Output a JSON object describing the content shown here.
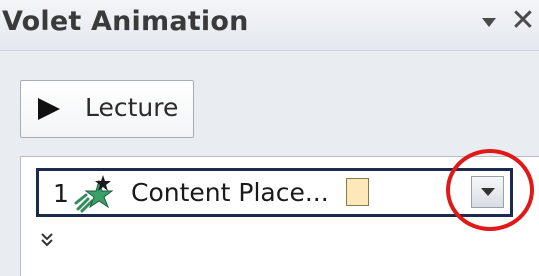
{
  "pane": {
    "title": "Volet Animation",
    "close_glyph": "✕",
    "menu_icon": "triangle-down-icon"
  },
  "play": {
    "label": "Lecture",
    "icon": "play-icon"
  },
  "animation_list": {
    "items": [
      {
        "number": "1",
        "label": "Content Place...",
        "effect_icon": "green-star-entrance-icon",
        "timing_color": "#fce8b8"
      }
    ],
    "expand_icon": "double-chevron-down-icon"
  },
  "annotation": {
    "highlight_color": "#e01818"
  }
}
